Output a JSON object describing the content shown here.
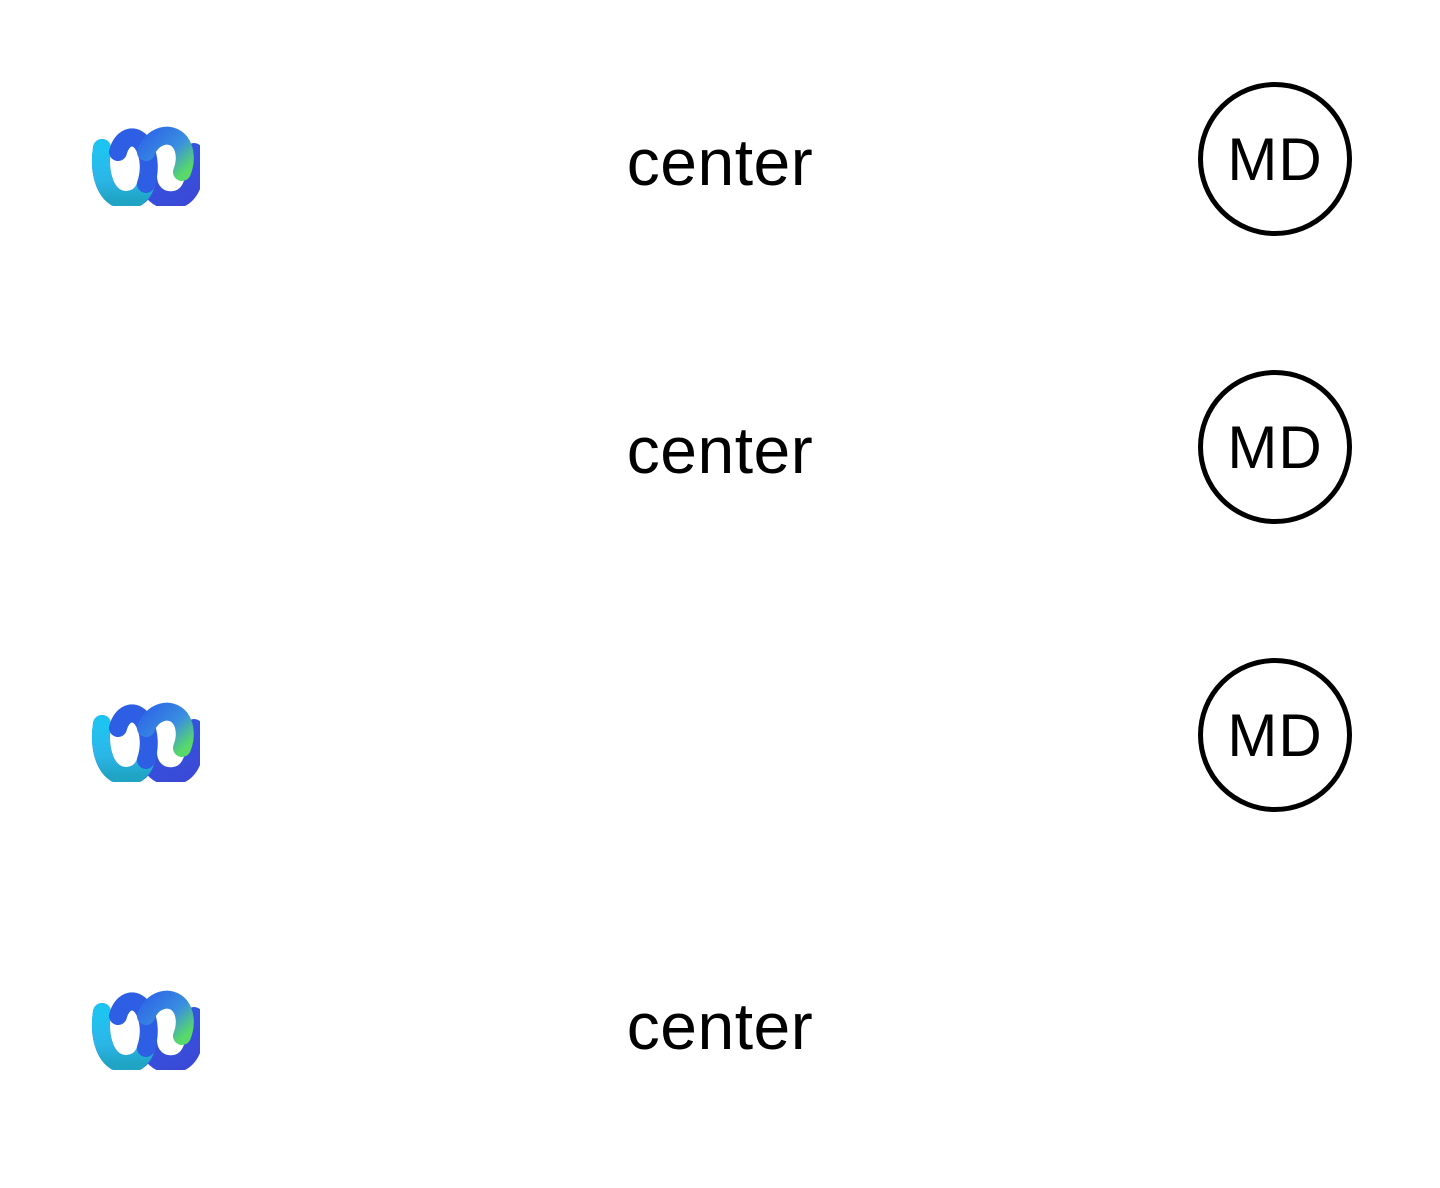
{
  "colors": {
    "logo_blue_dark": "#2b55e0",
    "logo_blue_light": "#21c3ef",
    "logo_green": "#4fd36f",
    "text": "#000000",
    "background": "#ffffff"
  },
  "rows": [
    {
      "logo_icon": "webex-logo-icon",
      "title": "center",
      "avatar_initials": "MD"
    },
    {
      "title": "center",
      "avatar_initials": "MD"
    },
    {
      "logo_icon": "webex-logo-icon",
      "avatar_initials": "MD"
    },
    {
      "logo_icon": "webex-logo-icon",
      "title": "center"
    }
  ]
}
